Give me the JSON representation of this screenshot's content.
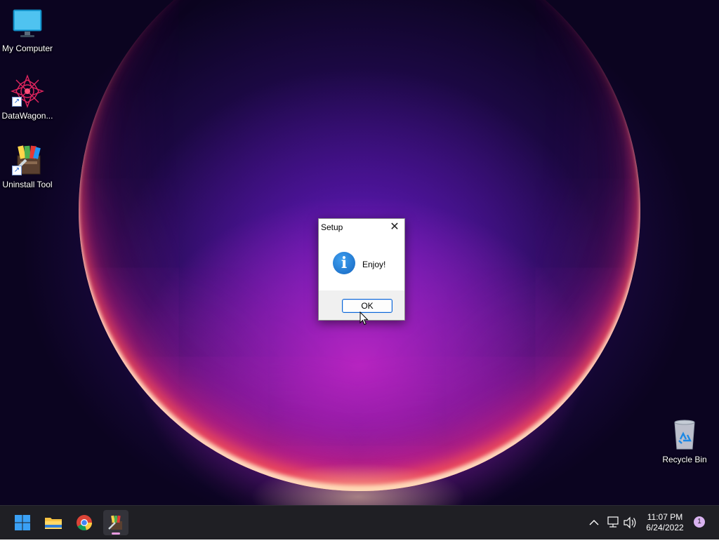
{
  "desktop": {
    "icons": [
      {
        "label": "My Computer",
        "icon": "monitor-icon"
      },
      {
        "label": "DataWagon...",
        "icon": "datawagon-app-icon"
      },
      {
        "label": "Uninstall Tool",
        "icon": "uninstall-tool-icon"
      },
      {
        "label": "Recycle Bin",
        "icon": "recycle-bin-icon"
      }
    ]
  },
  "dialog": {
    "title": "Setup",
    "close_glyph": "✕",
    "message": "Enjoy!",
    "info_glyph": "i",
    "ok_label": "OK"
  },
  "taskbar": {
    "pinned": [
      {
        "name": "start",
        "icon": "windows-start-icon"
      },
      {
        "name": "file-explorer",
        "icon": "folder-icon"
      },
      {
        "name": "chrome",
        "icon": "chrome-icon"
      },
      {
        "name": "uninstall-tool",
        "icon": "uninstall-tool-icon",
        "active": true
      }
    ],
    "tray": {
      "time": "11:07 PM",
      "date": "6/24/2022",
      "notification_count": "1"
    }
  },
  "colors": {
    "accent": "#0a64d6",
    "taskbar_bg": "#1f1f24",
    "active_indicator": "#e89ae0"
  }
}
